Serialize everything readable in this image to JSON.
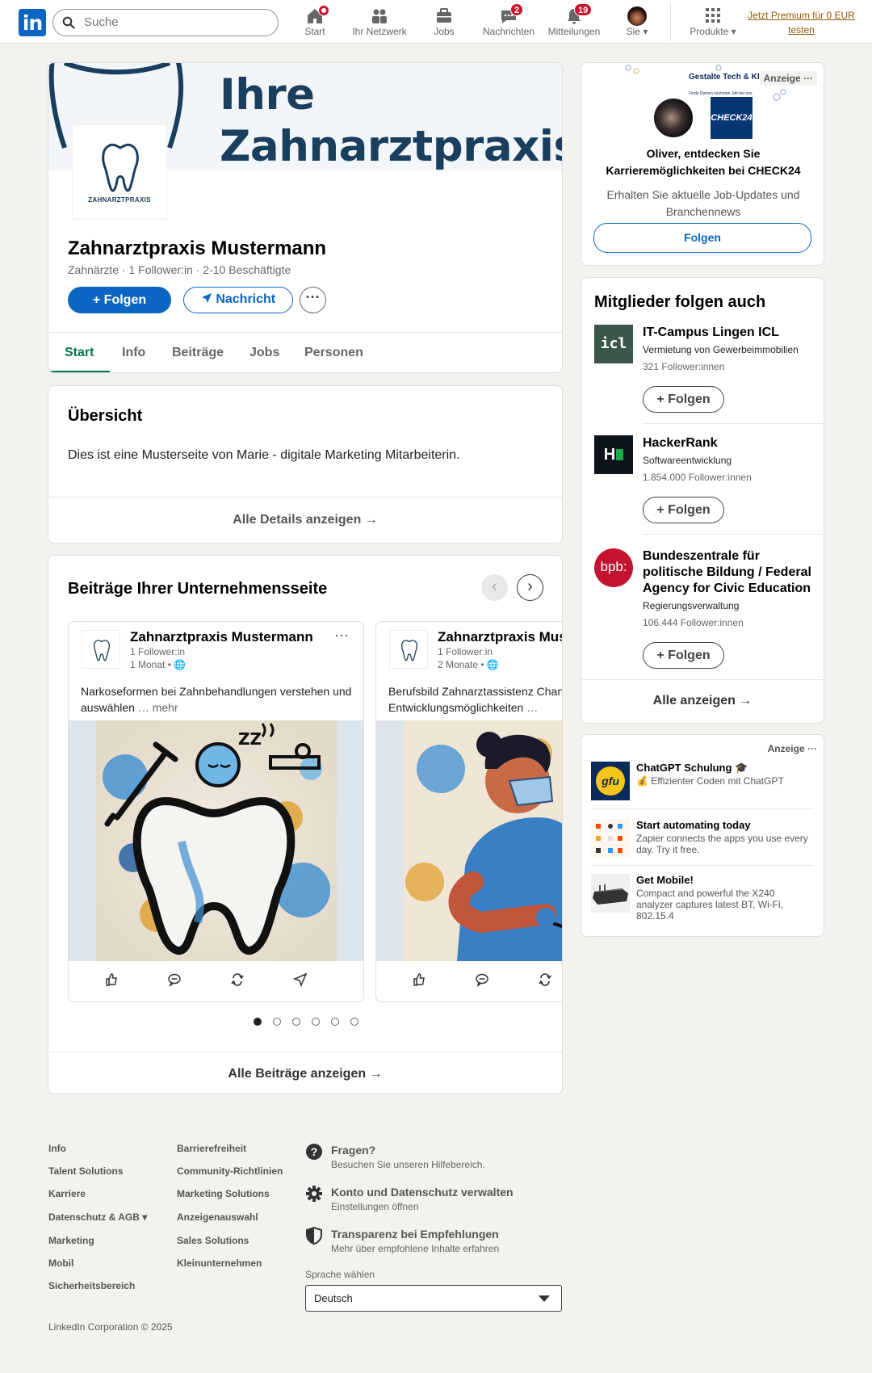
{
  "nav": {
    "search_placeholder": "Suche",
    "items": [
      {
        "label": "Start",
        "badge": ""
      },
      {
        "label": "Ihr Netzwerk",
        "badge": ""
      },
      {
        "label": "Jobs",
        "badge": ""
      },
      {
        "label": "Nachrichten",
        "badge": "2"
      },
      {
        "label": "Mitteilungen",
        "badge": "19"
      },
      {
        "label": "Sie"
      },
      {
        "label": "Produkte"
      }
    ],
    "premium": "Jetzt Premium für 0 EUR testen"
  },
  "company": {
    "banner_line1": "Ihre",
    "banner_line2": "Zahnarztpraxis",
    "logo_caption": "ZAHNARZTPRAXIS",
    "name": "Zahnarztpraxis Mustermann",
    "meta": "Zahnärzte · 1 Follower:in · 2-10 Beschäftigte",
    "follow_btn": "Folgen",
    "message_btn": "Nachricht",
    "tabs": [
      "Start",
      "Info",
      "Beiträge",
      "Jobs",
      "Personen"
    ]
  },
  "overview": {
    "title": "Übersicht",
    "text": "Dies ist eine Musterseite von Marie - digitale Marketing Mitarbeiterin.",
    "link": "Alle Details anzeigen →"
  },
  "posts": {
    "title": "Beiträge Ihrer Unternehmensseite",
    "items": [
      {
        "author": "Zahnarztpraxis Mustermann",
        "followers": "1 Follower:in",
        "time": "1 Monat •",
        "text": "Narkoseformen bei Zahnbehandlungen verstehen und auswählen",
        "more": " … mehr"
      },
      {
        "author": "Zahnarztpraxis Mustermann",
        "followers": "1 Follower:in",
        "time": "2 Monate •",
        "text": "Berufsbild Zahnarztassistenz Chancen und Entwicklungsmöglichkeiten",
        "more": " …"
      }
    ],
    "active_dot": 1,
    "dot_count": 6,
    "link": "Alle Beiträge anzeigen →"
  },
  "ad1": {
    "label": "Anzeige",
    "top_title": "Gestalte Tech & KI",
    "top_sub": "Finde Deinen nächsten Job bei uns.",
    "logo_text": "CHECK24",
    "headline": "Oliver, entdecken Sie Karrieremöglichkeiten bei CHECK24",
    "sub": "Erhalten Sie aktuelle Job-Updates und Branchennews",
    "btn": "Folgen"
  },
  "follows": {
    "title": "Mitglieder folgen auch",
    "items": [
      {
        "name": "IT-Campus Lingen ICL",
        "sub": "Vermietung von Gewerbeimmobilien",
        "count": "321 Follower:innen",
        "logo": "icl",
        "btn": "Folgen"
      },
      {
        "name": "HackerRank",
        "sub": "Softwareentwicklung",
        "count": "1.854.000 Follower:innen",
        "logo": "H",
        "btn": "Folgen"
      },
      {
        "name": "Bundeszentrale für politische Bildung / Federal Agency for Civic Education",
        "sub": "Regierungsverwaltung",
        "count": "106.444 Follower:innen",
        "logo": "bpb:",
        "btn": "Folgen"
      }
    ],
    "link": "Alle anzeigen →"
  },
  "ad2": {
    "label": "Anzeige",
    "items": [
      {
        "title": "ChatGPT Schulung 🎓",
        "sub": "💰 Effizienter Coden mit ChatGPT",
        "logo": "gfu"
      },
      {
        "title": "Start automating today",
        "sub": "Zapier connects the apps you use every day. Try it free."
      },
      {
        "title": "Get Mobile!",
        "sub": "Compact and powerful the X240 analyzer captures latest BT, Wi-Fi, 802.15.4"
      }
    ]
  },
  "footer": {
    "col1": [
      "Info",
      "Talent Solutions",
      "Karriere",
      "Datenschutz & AGB",
      "Marketing",
      "Mobil",
      "Sicherheitsbereich"
    ],
    "col2": [
      "Barrierefreiheit",
      "Community-Richtlinien",
      "Marketing Solutions",
      "Anzeigenauswahl",
      "Sales Solutions",
      "Kleinunternehmen"
    ],
    "help": [
      {
        "title": "Fragen?",
        "sub": "Besuchen Sie unseren Hilfebereich."
      },
      {
        "title": "Konto und Datenschutz verwalten",
        "sub": "Einstellungen öffnen"
      },
      {
        "title": "Transparenz bei Empfehlungen",
        "sub": "Mehr über empfohlene Inhalte erfahren"
      }
    ],
    "lang_label": "Sprache wählen",
    "lang_value": "Deutsch",
    "copyright": "LinkedIn Corporation © 2025"
  },
  "colors": {
    "brand": "#0a66c2",
    "tab_active": "#01754f",
    "badge": "#cb112d"
  }
}
